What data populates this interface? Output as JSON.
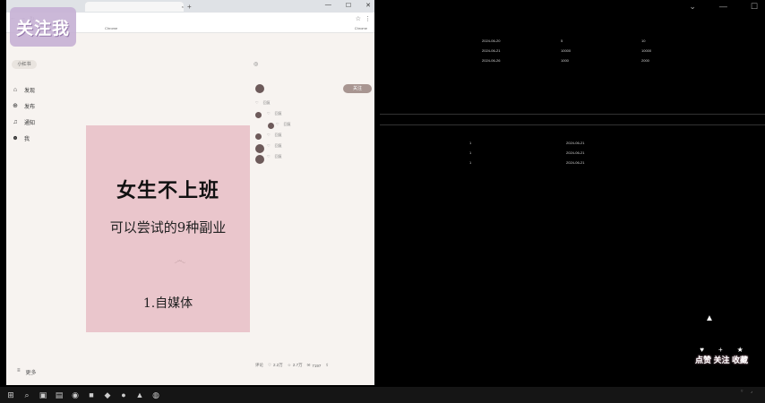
{
  "desktop": {
    "top_controls": [
      "⌄",
      "—",
      "☐"
    ],
    "sheet1": {
      "header": [
        "",
        "",
        "",
        "",
        "",
        "",
        "",
        ""
      ],
      "rows": [
        [
          "",
          "",
          "2024-06-20",
          "",
          "5",
          "",
          "10",
          ""
        ],
        [
          "",
          "",
          "2024-06-21",
          "",
          "10000",
          "",
          "10000",
          ""
        ],
        [
          "",
          "",
          "2024-06-26",
          "",
          "1000",
          "",
          "2000",
          ""
        ]
      ]
    },
    "sheet2": {
      "rows": [
        [
          "",
          "1",
          "2024-06-21",
          "",
          ""
        ],
        [
          "",
          "1",
          "2024-06-21",
          "",
          ""
        ],
        [
          "",
          "1",
          "2024-06-21",
          "",
          ""
        ]
      ]
    }
  },
  "browser": {
    "tab_title": "",
    "url": "",
    "infobar_text": "Chrome",
    "infobar_right": "Chrome"
  },
  "site": {
    "logo": "小红书",
    "nav": [
      {
        "icon": "⌂",
        "label": "发现"
      },
      {
        "icon": "⊕",
        "label": "发布"
      },
      {
        "icon": "♫",
        "label": "通知"
      },
      {
        "icon": "☻",
        "label": "我"
      }
    ],
    "more": "更多"
  },
  "note": {
    "title": "女生不上班",
    "subtitle": "可以尝试的9种副业",
    "item": "1.自媒体"
  },
  "post": {
    "follow": "关注",
    "comments": [
      {
        "text": "",
        "meta": "",
        "acts": [
          "♡",
          "回复"
        ],
        "expand": ""
      },
      {
        "text": "",
        "meta": "",
        "acts": [
          "♡",
          "回复"
        ],
        "expand": ""
      },
      {
        "text": "",
        "meta": "",
        "acts": [
          "♡",
          "回复"
        ],
        "expand": ""
      },
      {
        "text": "",
        "meta": "",
        "acts": [
          "♡",
          "回复"
        ],
        "expand": ""
      },
      {
        "text": "",
        "meta": "",
        "acts": [
          "♡",
          "回复"
        ],
        "expand": ""
      },
      {
        "text": "",
        "meta": "",
        "acts": [
          "♡",
          "回复"
        ],
        "expand": ""
      }
    ],
    "bottom": {
      "comment_ph": "评论",
      "likes": "2.2万",
      "stars": "2.7万",
      "comments": "7197"
    }
  },
  "overlays": {
    "watermark": "关注我",
    "cta_icons": [
      "♥",
      "+",
      "★"
    ],
    "cta": "点赞 关注 收藏"
  },
  "taskbar": {
    "temp": "",
    "time": "",
    "date": ""
  },
  "colors": {
    "note_bg": "#eac6cc",
    "follow_btn": "#a89591",
    "watermark_bg": "#c8b3d6"
  }
}
